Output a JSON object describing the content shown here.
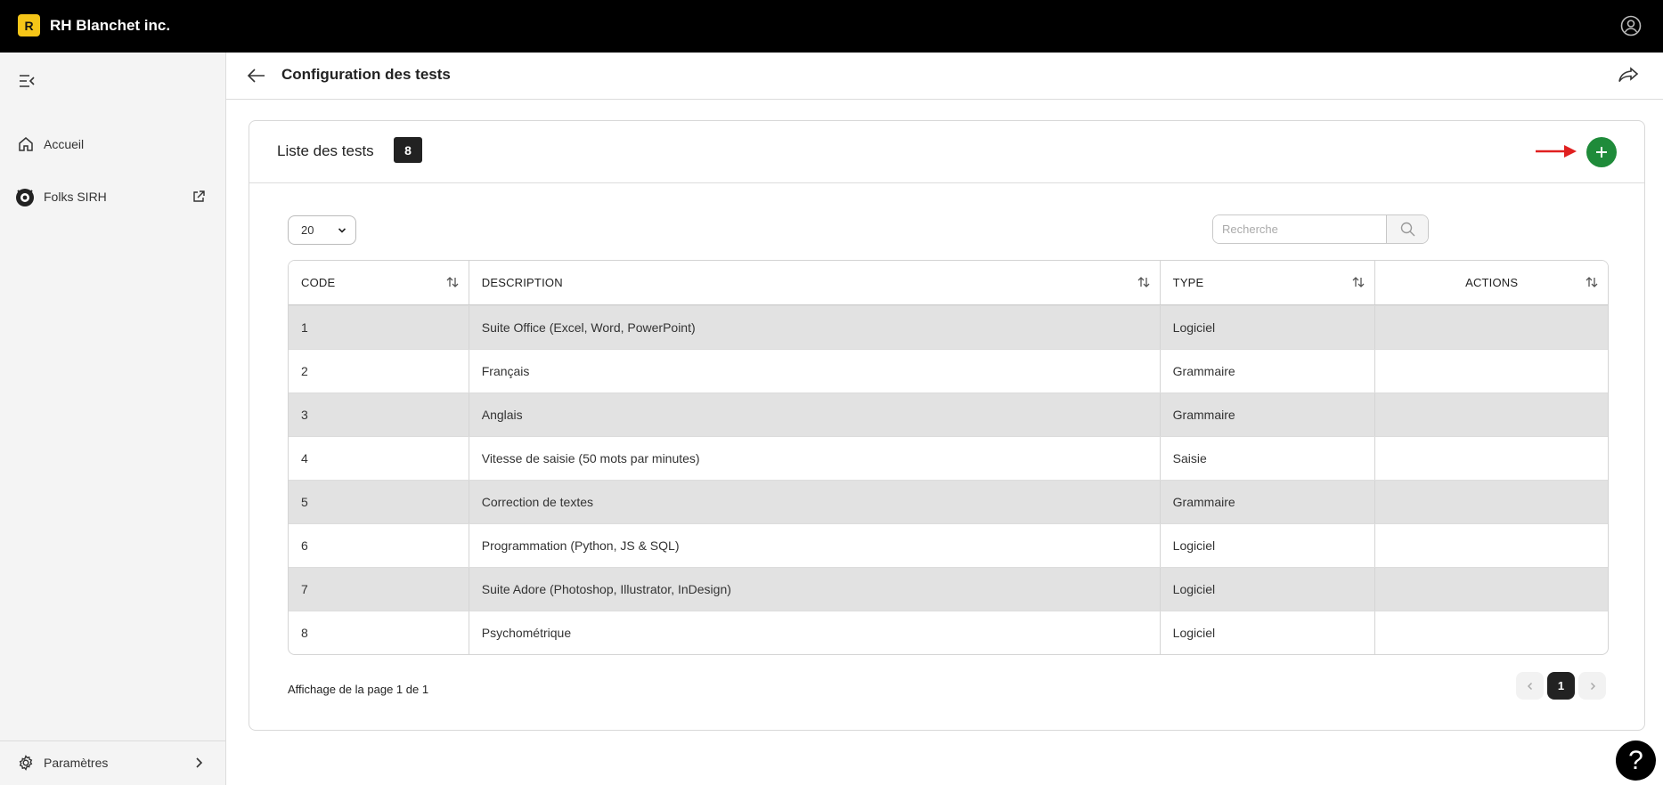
{
  "app": {
    "logo_letter": "R",
    "brand": "RH Blanchet inc."
  },
  "sidebar": {
    "items": [
      {
        "label": "Accueil",
        "icon": "home-icon"
      },
      {
        "label": "Folks SIRH",
        "icon": "folks-logo-icon",
        "trailing_icon": "external-link-icon"
      }
    ],
    "settings_label": "Paramètres"
  },
  "header": {
    "title": "Configuration des tests"
  },
  "card": {
    "title": "Liste des tests",
    "count": "8",
    "page_size": "20",
    "search_placeholder": "Recherche"
  },
  "table": {
    "columns": [
      "CODE",
      "DESCRIPTION",
      "TYPE",
      "ACTIONS"
    ],
    "rows": [
      {
        "code": "1",
        "description": "Suite Office (Excel, Word, PowerPoint)",
        "type": "Logiciel"
      },
      {
        "code": "2",
        "description": "Français",
        "type": "Grammaire"
      },
      {
        "code": "3",
        "description": "Anglais",
        "type": "Grammaire"
      },
      {
        "code": "4",
        "description": "Vitesse de saisie (50 mots par minutes)",
        "type": "Saisie"
      },
      {
        "code": "5",
        "description": "Correction de textes",
        "type": "Grammaire"
      },
      {
        "code": "6",
        "description": "Programmation (Python, JS & SQL)",
        "type": "Logiciel"
      },
      {
        "code": "7",
        "description": "Suite Adore (Photoshop, Illustrator, InDesign)",
        "type": "Logiciel"
      },
      {
        "code": "8",
        "description": "Psychométrique",
        "type": "Logiciel"
      }
    ]
  },
  "pagination": {
    "info": "Affichage de la page 1 de 1",
    "current": "1"
  },
  "help": {
    "label": "?"
  },
  "colors": {
    "accent_green": "#1f8b3a",
    "logo_yellow": "#f5c518",
    "annotation_red": "#e02020"
  }
}
